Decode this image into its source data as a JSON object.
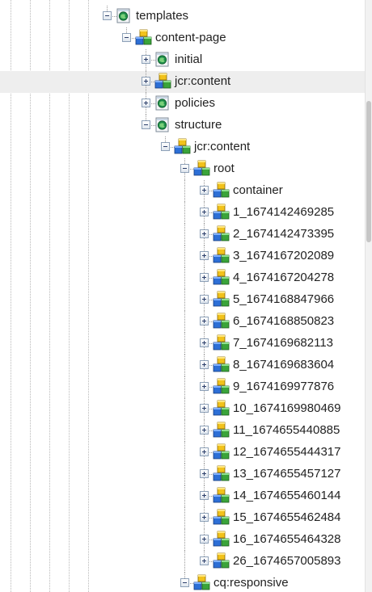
{
  "tree": {
    "nodes": [
      {
        "label": "templates",
        "depth": 0,
        "icon": "page-folder-icon",
        "state": "expanded"
      },
      {
        "label": "content-page",
        "depth": 1,
        "icon": "node-cubes-icon",
        "state": "expanded"
      },
      {
        "label": "initial",
        "depth": 2,
        "icon": "page-folder-icon",
        "state": "collapsed"
      },
      {
        "label": "jcr:content",
        "depth": 2,
        "icon": "node-cubes-icon",
        "state": "collapsed",
        "highlighted": true
      },
      {
        "label": "policies",
        "depth": 2,
        "icon": "page-folder-icon",
        "state": "collapsed"
      },
      {
        "label": "structure",
        "depth": 2,
        "icon": "page-folder-icon",
        "state": "expanded"
      },
      {
        "label": "jcr:content",
        "depth": 3,
        "icon": "node-cubes-icon",
        "state": "expanded"
      },
      {
        "label": "root",
        "depth": 4,
        "icon": "node-cubes-icon",
        "state": "expanded"
      },
      {
        "label": "container",
        "depth": 5,
        "icon": "node-cubes-icon",
        "state": "collapsed"
      },
      {
        "label": "1_1674142469285",
        "depth": 5,
        "icon": "node-cubes-icon",
        "state": "collapsed"
      },
      {
        "label": "2_1674142473395",
        "depth": 5,
        "icon": "node-cubes-icon",
        "state": "collapsed"
      },
      {
        "label": "3_1674167202089",
        "depth": 5,
        "icon": "node-cubes-icon",
        "state": "collapsed"
      },
      {
        "label": "4_1674167204278",
        "depth": 5,
        "icon": "node-cubes-icon",
        "state": "collapsed"
      },
      {
        "label": "5_1674168847966",
        "depth": 5,
        "icon": "node-cubes-icon",
        "state": "collapsed"
      },
      {
        "label": "6_1674168850823",
        "depth": 5,
        "icon": "node-cubes-icon",
        "state": "collapsed"
      },
      {
        "label": "7_1674169682113",
        "depth": 5,
        "icon": "node-cubes-icon",
        "state": "collapsed"
      },
      {
        "label": "8_1674169683604",
        "depth": 5,
        "icon": "node-cubes-icon",
        "state": "collapsed"
      },
      {
        "label": "9_1674169977876",
        "depth": 5,
        "icon": "node-cubes-icon",
        "state": "collapsed"
      },
      {
        "label": "10_1674169980469",
        "depth": 5,
        "icon": "node-cubes-icon",
        "state": "collapsed"
      },
      {
        "label": "11_1674655440885",
        "depth": 5,
        "icon": "node-cubes-icon",
        "state": "collapsed"
      },
      {
        "label": "12_1674655444317",
        "depth": 5,
        "icon": "node-cubes-icon",
        "state": "collapsed"
      },
      {
        "label": "13_1674655457127",
        "depth": 5,
        "icon": "node-cubes-icon",
        "state": "collapsed"
      },
      {
        "label": "14_1674655460144",
        "depth": 5,
        "icon": "node-cubes-icon",
        "state": "collapsed"
      },
      {
        "label": "15_1674655462484",
        "depth": 5,
        "icon": "node-cubes-icon",
        "state": "collapsed"
      },
      {
        "label": "16_1674655464328",
        "depth": 5,
        "icon": "node-cubes-icon",
        "state": "collapsed"
      },
      {
        "label": "26_1674657005893",
        "depth": 5,
        "icon": "node-cubes-icon",
        "state": "collapsed"
      },
      {
        "label": "cq:responsive",
        "depth": 4,
        "icon": "node-cubes-icon",
        "state": "expanded"
      }
    ]
  },
  "colors": {
    "highlight_row": "#eeeeee",
    "cube_blue": "#2d6fd6",
    "cube_yellow": "#f2c21b",
    "cube_green": "#3aa43a",
    "page_green": "#1f8f4a"
  }
}
